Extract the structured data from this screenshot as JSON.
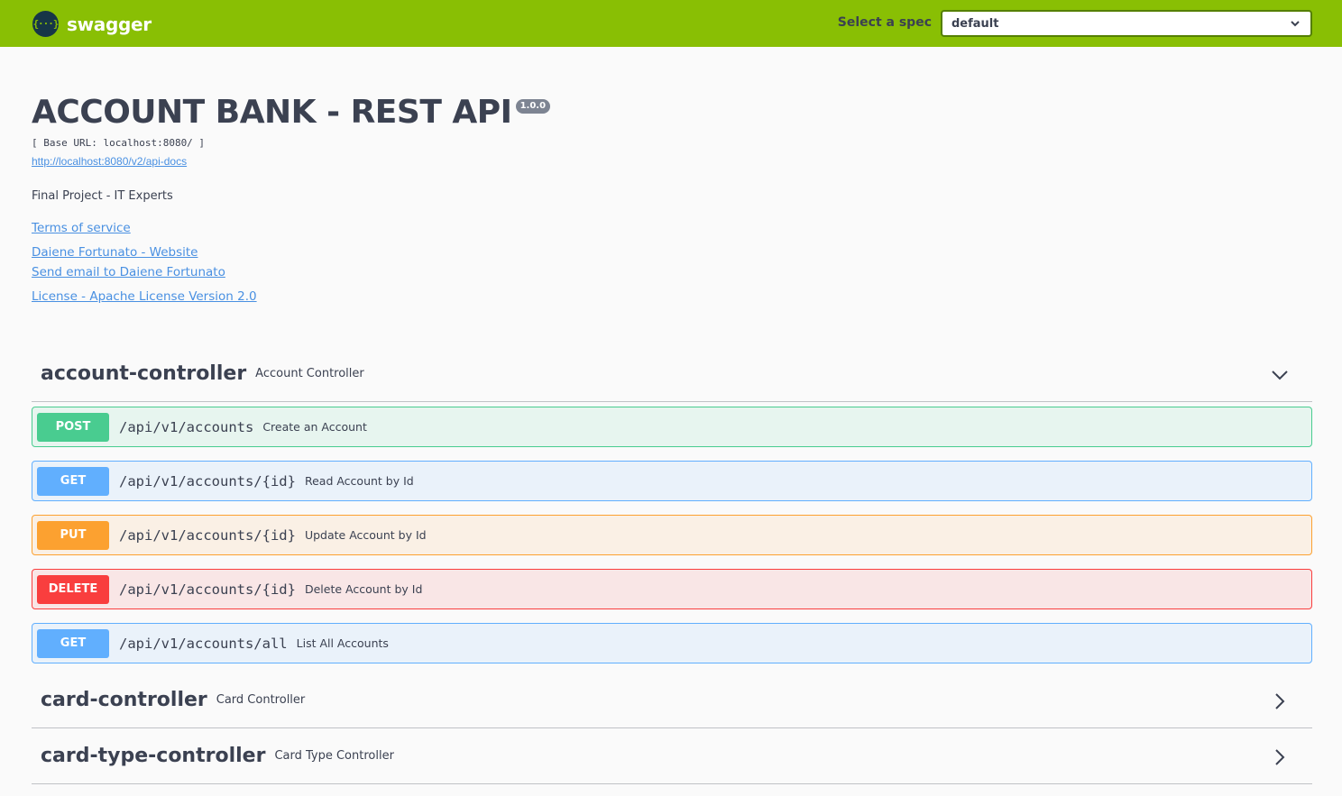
{
  "topbar": {
    "logo_icon": "swagger-braces-icon",
    "logo_glyph": "{···}",
    "logo_text": "swagger",
    "spec_label": "Select a spec",
    "spec_value": "default",
    "bg_color": "#89bf04"
  },
  "info": {
    "title": "ACCOUNT BANK - REST API",
    "version": "1.0.0",
    "base_url": "[ Base URL: localhost:8080/ ]",
    "docs_link": "http://localhost:8080/v2/api-docs",
    "description": "Final Project - IT Experts",
    "terms": "Terms of service",
    "website": "Daiene Fortunato - Website",
    "email": "Send email to Daiene Fortunato",
    "license": "License - Apache License Version 2.0"
  },
  "tags": [
    {
      "name": "account-controller",
      "description": "Account Controller",
      "expanded": true,
      "operations": [
        {
          "method": "POST",
          "path": "/api/v1/accounts",
          "summary": "Create an Account",
          "color": "#49cc90"
        },
        {
          "method": "GET",
          "path": "/api/v1/accounts/{id}",
          "summary": "Read Account by Id",
          "color": "#61affe"
        },
        {
          "method": "PUT",
          "path": "/api/v1/accounts/{id}",
          "summary": "Update Account by Id",
          "color": "#fca130"
        },
        {
          "method": "DELETE",
          "path": "/api/v1/accounts/{id}",
          "summary": "Delete Account by Id",
          "color": "#f93e3e"
        },
        {
          "method": "GET",
          "path": "/api/v1/accounts/all",
          "summary": "List All Accounts",
          "color": "#61affe"
        }
      ]
    },
    {
      "name": "card-controller",
      "description": "Card Controller",
      "expanded": false
    },
    {
      "name": "card-type-controller",
      "description": "Card Type Controller",
      "expanded": false
    }
  ]
}
